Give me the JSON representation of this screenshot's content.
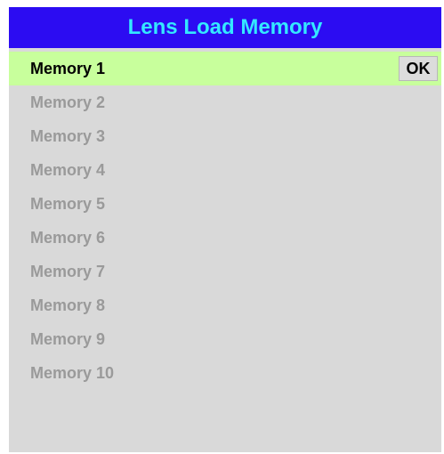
{
  "menu": {
    "title": "Lens Load Memory",
    "ok_label": "OK",
    "items": [
      {
        "label": "Memory 1"
      },
      {
        "label": "Memory 2"
      },
      {
        "label": "Memory 3"
      },
      {
        "label": "Memory 4"
      },
      {
        "label": "Memory 5"
      },
      {
        "label": "Memory 6"
      },
      {
        "label": "Memory 7"
      },
      {
        "label": "Memory 8"
      },
      {
        "label": "Memory 9"
      },
      {
        "label": "Memory 10"
      }
    ]
  },
  "colors": {
    "header_bg": "#2c0cf2",
    "header_text": "#34e8ff",
    "panel_bg": "#d9d9d9",
    "selected_bg": "#c8ff9c",
    "disabled_text": "#9a9a9a"
  }
}
